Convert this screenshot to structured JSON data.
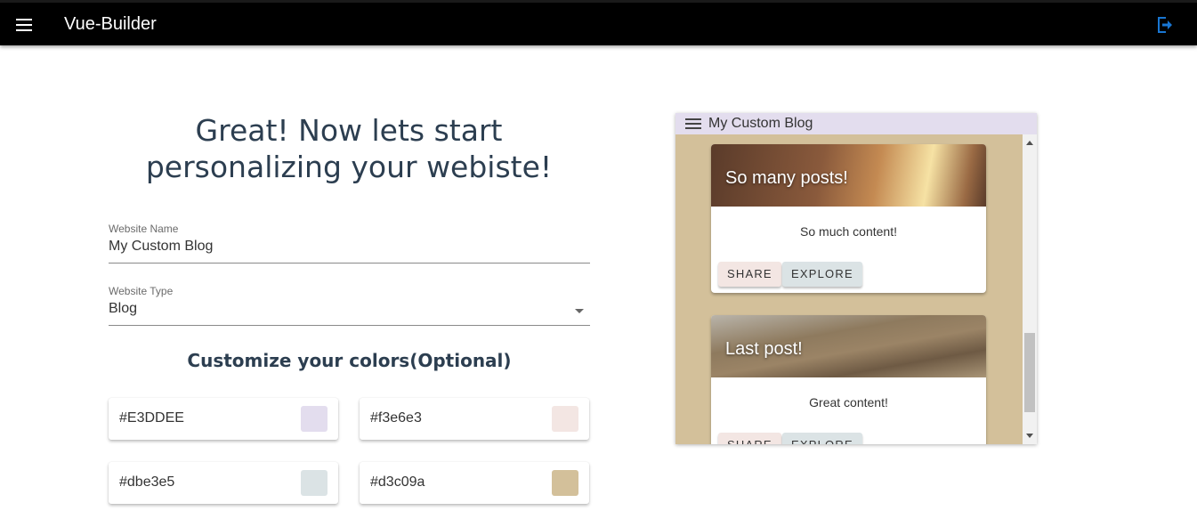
{
  "app": {
    "title": "Vue-Builder"
  },
  "form": {
    "heading": "Great! Now lets start personalizing your webiste!",
    "website_name": {
      "label": "Website Name",
      "value": "My Custom Blog"
    },
    "website_type": {
      "label": "Website Type",
      "value": "Blog"
    },
    "colors_heading": "Customize your colors(Optional)",
    "colors": [
      {
        "hex": "#E3DDEE",
        "swatch": "#E3DDEE"
      },
      {
        "hex": "#f3e6e3",
        "swatch": "#f3e6e3"
      },
      {
        "hex": "#dbe3e5",
        "swatch": "#dbe3e5"
      },
      {
        "hex": "#d3c09a",
        "swatch": "#d3c09a"
      }
    ]
  },
  "preview": {
    "title": "My Custom Blog",
    "posts": [
      {
        "title": "So many posts!",
        "text": "So much content!",
        "share": "SHARE",
        "explore": "EXPLORE"
      },
      {
        "title": "Last post!",
        "text": "Great content!",
        "share": "SHARE",
        "explore": "EXPLORE"
      }
    ]
  },
  "icons": {
    "menu": "menu-icon",
    "logout": "logout-icon",
    "dropdown": "chevron-down-icon"
  }
}
